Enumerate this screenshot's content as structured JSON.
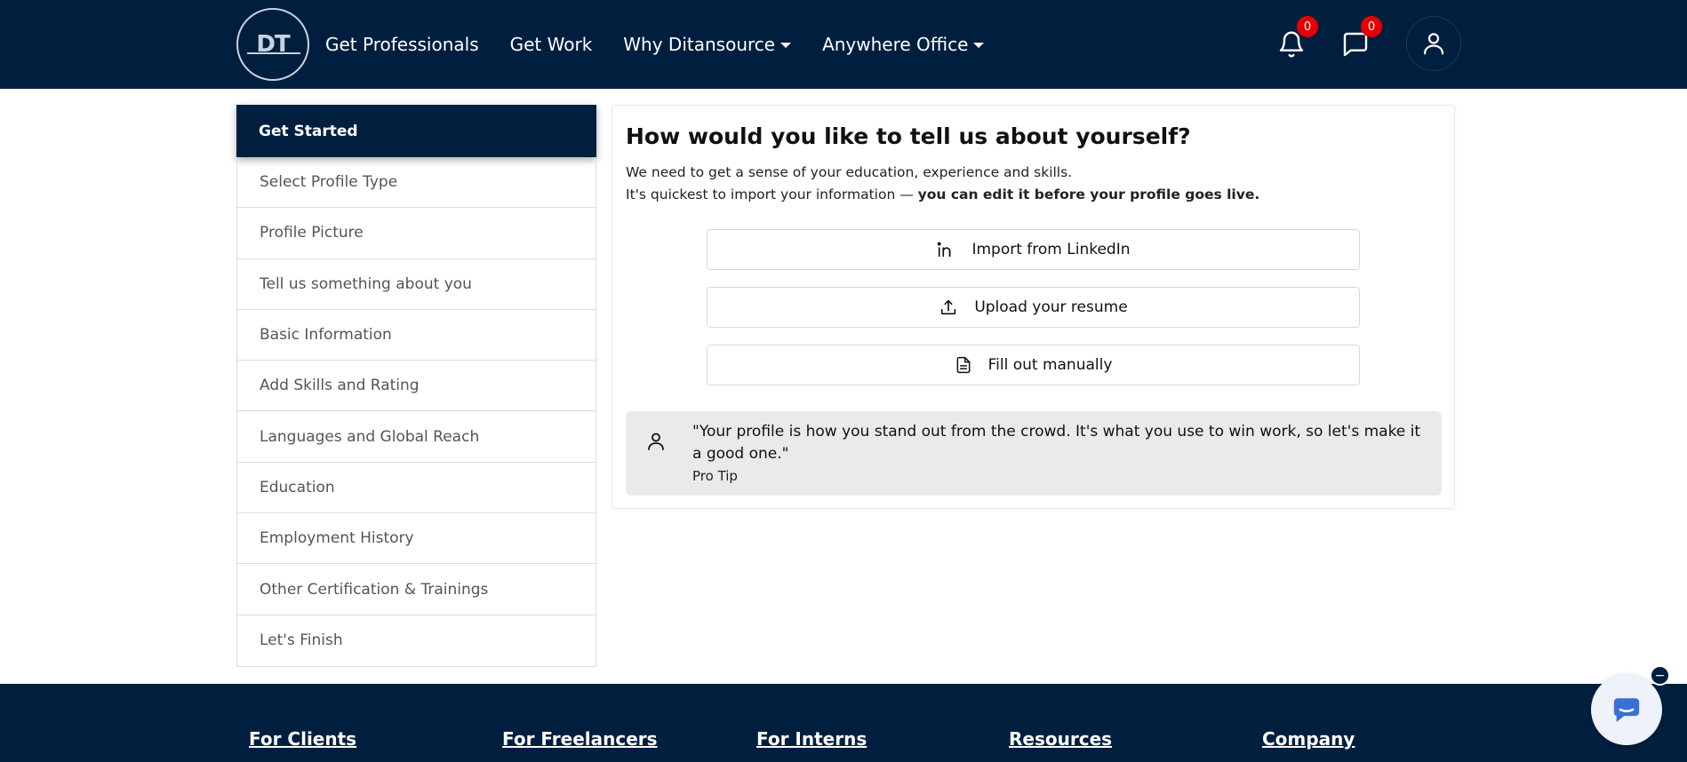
{
  "header": {
    "logo_text": "DT",
    "nav": [
      {
        "label": "Get Professionals",
        "dropdown": false
      },
      {
        "label": "Get Work",
        "dropdown": false
      },
      {
        "label": "Why Ditansource",
        "dropdown": true
      },
      {
        "label": "Anywhere Office",
        "dropdown": true
      }
    ],
    "notifications_count": "0",
    "messages_count": "0"
  },
  "sidebar": {
    "active": "Get Started",
    "items": [
      "Select Profile Type",
      "Profile Picture",
      "Tell us something about you",
      "Basic Information",
      "Add Skills and Rating",
      "Languages and Global Reach",
      "Education",
      "Employment History",
      "Other Certification & Trainings",
      "Let's Finish"
    ]
  },
  "main": {
    "title": "How would you like to tell us about yourself?",
    "intro_line1": "We need to get a sense of your education, experience and skills.",
    "intro_line2_prefix": "It's quickest to import your information — ",
    "intro_line2_bold": "you can edit it before your profile goes live.",
    "options": [
      {
        "label": "Import from LinkedIn",
        "icon": "linkedin-icon"
      },
      {
        "label": "Upload your resume",
        "icon": "upload-icon"
      },
      {
        "label": "Fill out manually",
        "icon": "document-icon"
      }
    ],
    "tip": {
      "quote": "\"Your profile is how you stand out from the crowd. It's what you use to win work, so let's make it a good one.\"",
      "author": "Pro Tip"
    }
  },
  "footer": {
    "links": [
      "For Clients",
      "For Freelancers",
      "For Interns",
      "Resources",
      "Company"
    ]
  },
  "chat": {
    "minimize_label": "−"
  },
  "colors": {
    "navy": "#001f3f",
    "badge": "#e60000",
    "tip_bg": "#e9eaec",
    "chat_icon": "#3b6fd8"
  }
}
